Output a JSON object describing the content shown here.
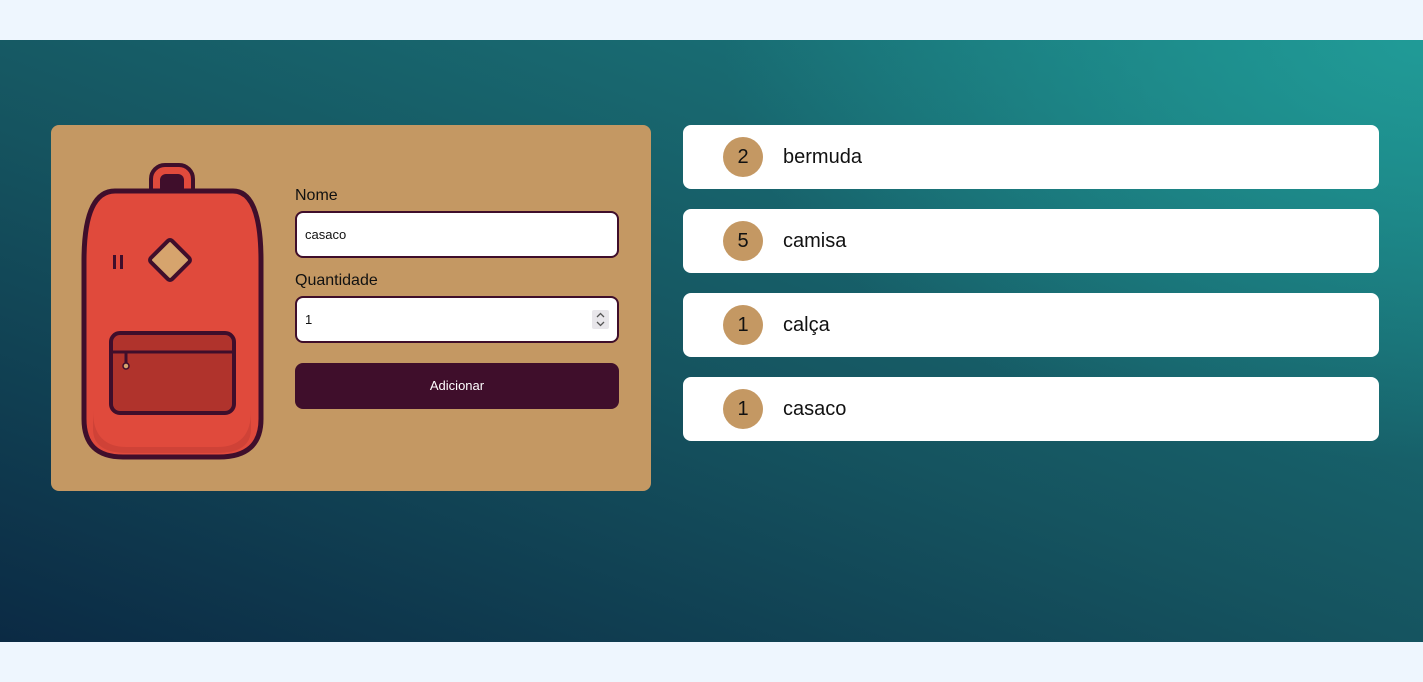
{
  "form": {
    "name_label": "Nome",
    "name_value": "casaco",
    "quantity_label": "Quantidade",
    "quantity_value": "1",
    "submit_label": "Adicionar"
  },
  "list": {
    "items": [
      {
        "quantity": "2",
        "name": "bermuda"
      },
      {
        "quantity": "5",
        "name": "camisa"
      },
      {
        "quantity": "1",
        "name": "calça"
      },
      {
        "quantity": "1",
        "name": "casaco"
      }
    ]
  },
  "colors": {
    "card": "#c49863",
    "accent": "#3f0e2b",
    "backpack": "#e04a3c",
    "background_dark": "#0b2a44",
    "background_teal": "#21a09b"
  },
  "icons": {
    "backpack": "backpack-illustration",
    "stepper": "number-stepper-icon"
  }
}
